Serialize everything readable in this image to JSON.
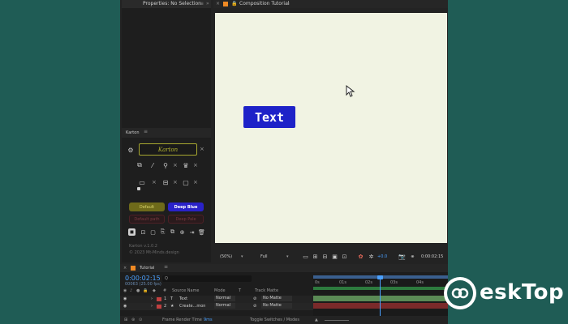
{
  "properties_panel": {
    "title": "Properties: No Selection"
  },
  "composition_panel": {
    "tab_label": "Composition Tutorial",
    "text_layer_preview": "Text",
    "preview_bg": "#f1f3e3",
    "text_box_color": "#1e22c8",
    "zoom": "(50%)",
    "resolution": "Full",
    "camera_label": "+0.0",
    "timecode_readout": "0:00:02:15"
  },
  "karton_panel": {
    "title": "Karton",
    "name_field_value": "Karton",
    "preset_buttons": [
      "Default",
      "Deep Blue",
      "Default path",
      "Deep Pale"
    ],
    "version_text": "Karton v.1.0.2",
    "copyright_text": "© 2023 Mt-Minds.design",
    "colors": {
      "default": "#6e6a1a",
      "deep_blue": "#2a22c9",
      "muted_red": "#4d2026"
    }
  },
  "timeline": {
    "tab_label": "Tutorial",
    "timecode": "0:00:02:15",
    "frame_info": "00063 (25.00 fps)",
    "search_placeholder": "Q",
    "columns": {
      "source_name": "Source Name",
      "mode": "Mode",
      "t": "T",
      "track_matte": "Track Matte"
    },
    "layers": [
      {
        "index": "1",
        "type_icon": "T",
        "name": "Text",
        "mode": "Normal",
        "matte": "No Matte"
      },
      {
        "index": "2",
        "type_icon": "★",
        "name": "Create...mon",
        "mode": "Normal",
        "matte": "No Matte"
      }
    ],
    "ruler_labels": [
      "0s",
      "01s",
      "02s",
      "03s",
      "04s"
    ],
    "footer": {
      "render_time_label": "Frame Render Time",
      "render_time_value": "9ms",
      "toggle_label": "Toggle Switches / Modes"
    }
  },
  "watermark": {
    "text": "eskTop"
  }
}
